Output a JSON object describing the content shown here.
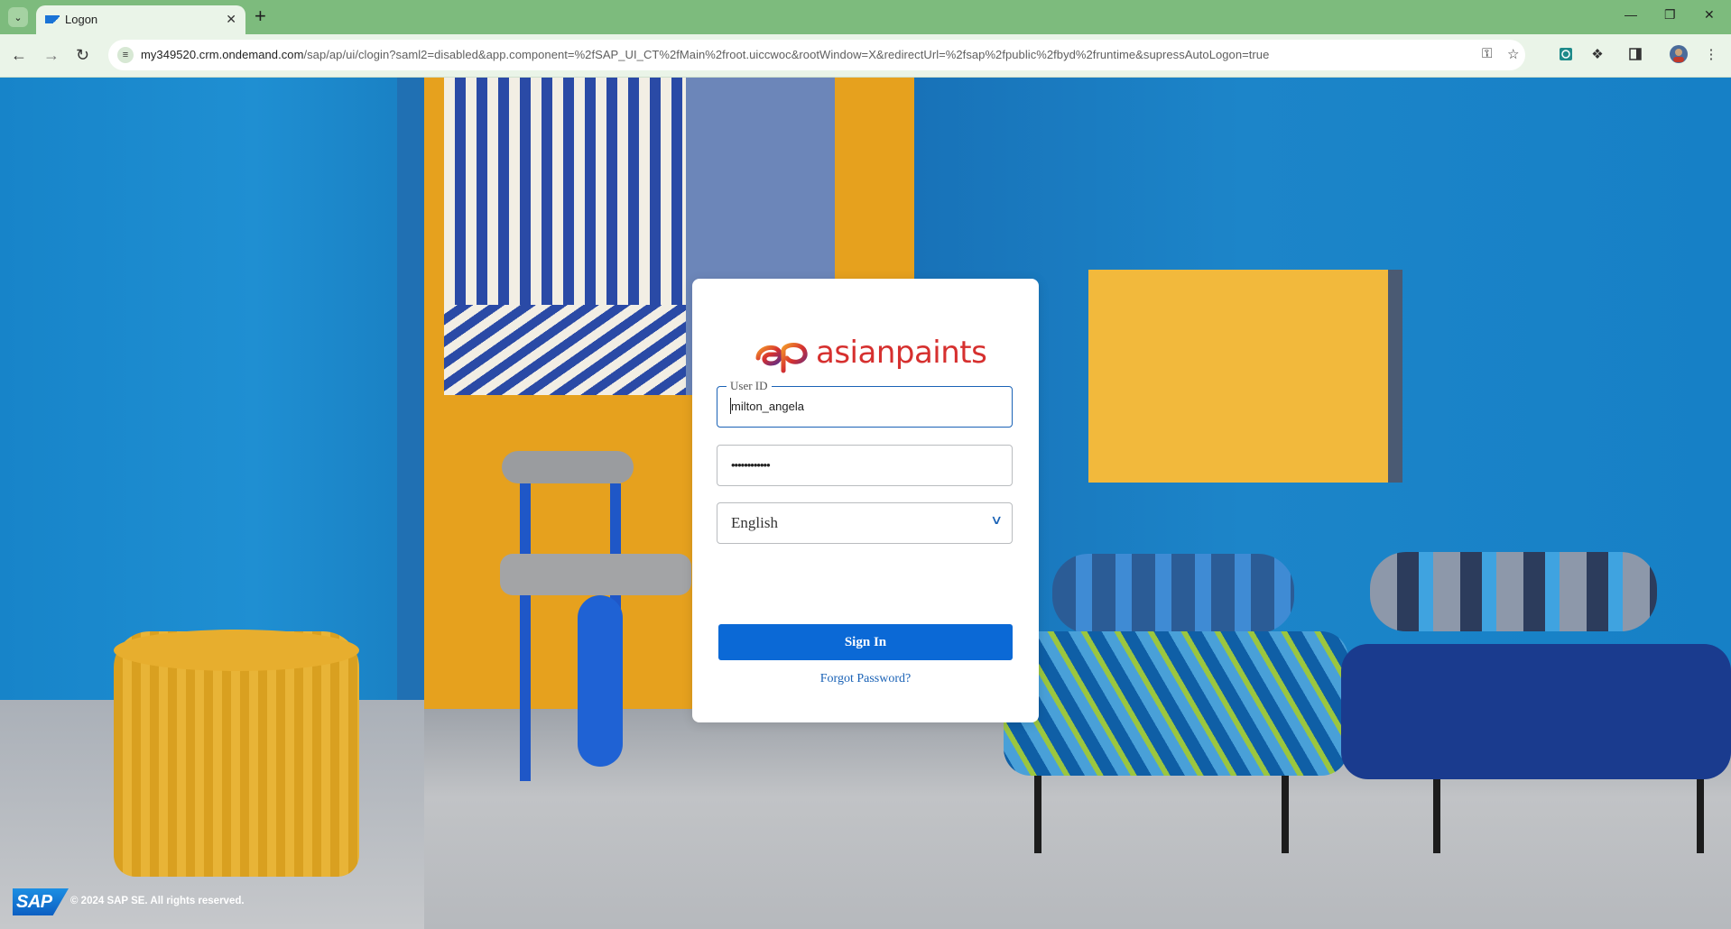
{
  "browser": {
    "tab": {
      "title": "Logon"
    },
    "new_tab_label": "+",
    "url_host": "my349520.crm.ondemand.com",
    "url_path": "/sap/ap/ui/clogin?saml2=disabled&app.component=%2fSAP_UI_CT%2fMain%2froot.uiccwoc&rootWindow=X&redirectUrl=%2fsap%2fpublic%2fbyd%2fruntime&supressAutoLogon=true"
  },
  "login": {
    "logo_text": "asianpaints",
    "user_id": {
      "legend": "User ID",
      "value": "milton_angela"
    },
    "password": {
      "value": "••••••••••••"
    },
    "language": {
      "selected": "English"
    },
    "signin_label": "Sign In",
    "forgot_label": "Forgot Password?"
  },
  "footer": {
    "sap_logo_text": "SAP",
    "copyright": "© 2024 SAP SE. All rights reserved."
  },
  "colors": {
    "browser_frame": "#7dbb7d",
    "primary_button": "#0b69d6",
    "logo_red": "#d6302f",
    "link": "#1a62b6"
  }
}
